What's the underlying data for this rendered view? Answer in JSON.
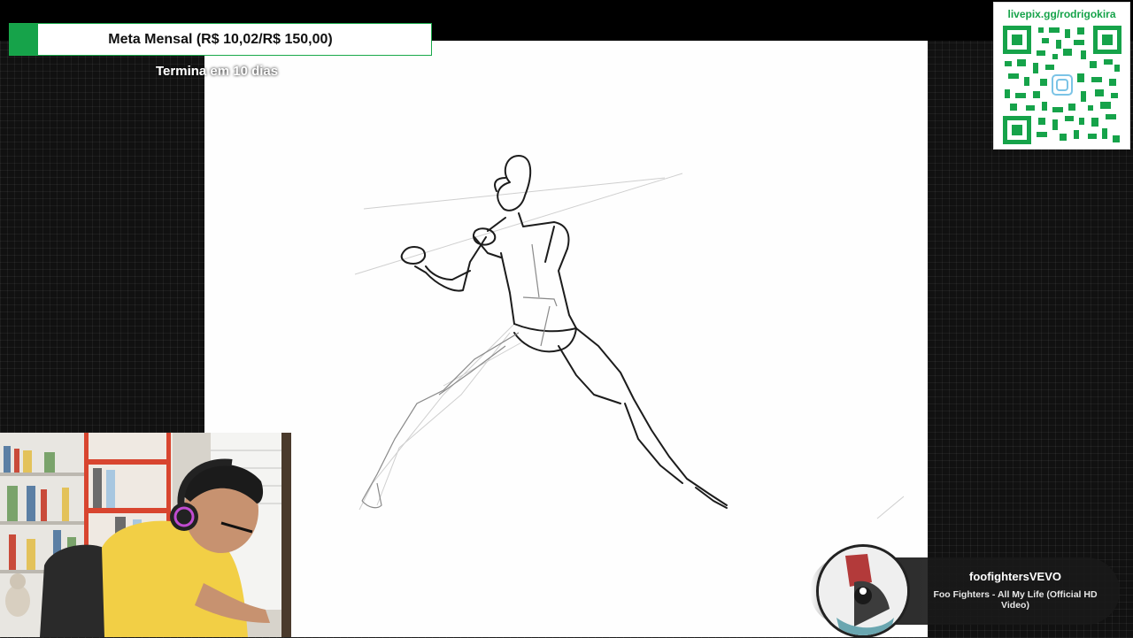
{
  "goal": {
    "title": "Meta Mensal (R$ 10,02/R$ 150,00)",
    "subtitle": "Termina em 10 dias",
    "current": 10.02,
    "target": 150.0,
    "accent_color": "#16a34a"
  },
  "donation": {
    "url": "livepix.gg/rodrigokira",
    "qr_color": "#16a34a"
  },
  "now_playing": {
    "artist": "foofightersVEVO",
    "track": "Foo Fighters - All My Life (Official HD Video)"
  },
  "canvas": {
    "content": "figure-sketch"
  }
}
